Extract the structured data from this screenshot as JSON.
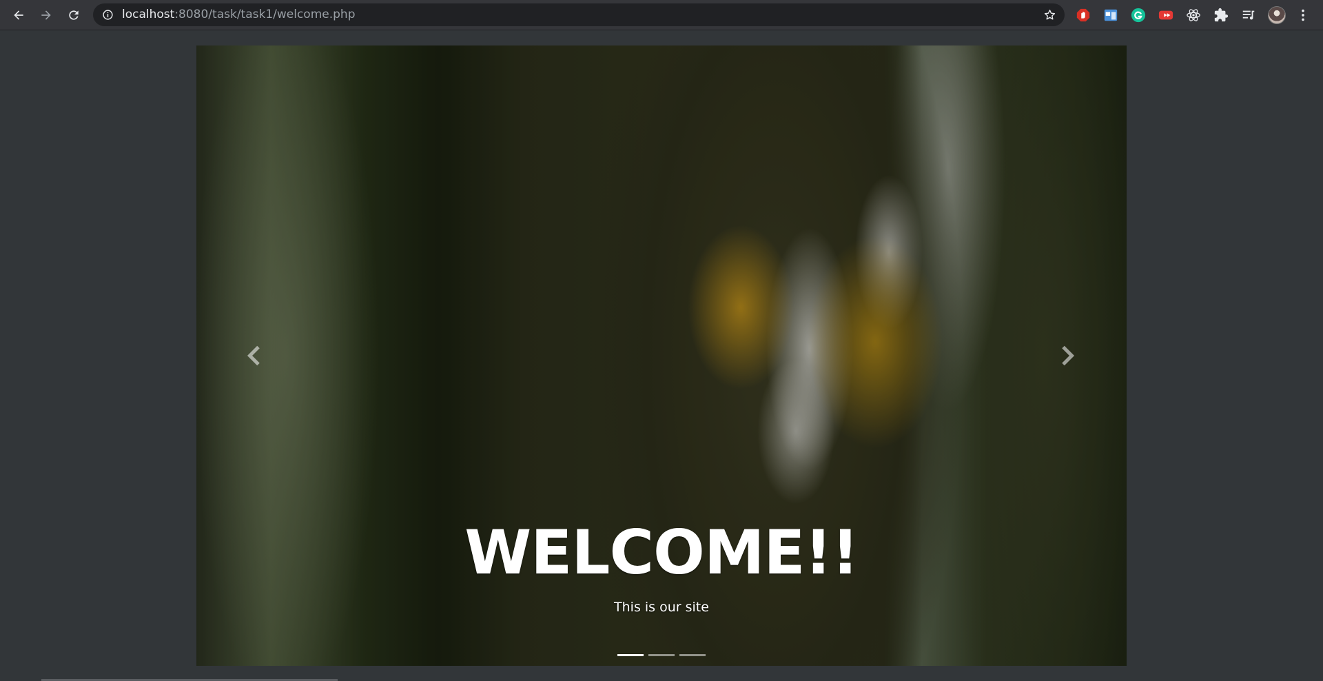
{
  "browser": {
    "back_icon": "arrow-left-icon",
    "forward_icon": "arrow-right-icon",
    "reload_icon": "reload-icon",
    "url_host": "localhost",
    "url_rest": ":8080/task/task1/welcome.php",
    "bookmark_icon": "star-icon",
    "extensions": [
      {
        "name": "adblock-icon",
        "color": "#d93025"
      },
      {
        "name": "window-icon",
        "color": "#4a90d9"
      },
      {
        "name": "grammarly-icon",
        "color": "#15c39a"
      },
      {
        "name": "youtube-icon",
        "color": "#e53935"
      },
      {
        "name": "react-icon",
        "color": "#e8eaed"
      },
      {
        "name": "puzzle-icon",
        "color": "#e8eaed"
      },
      {
        "name": "reading-list-icon",
        "color": "#e8eaed"
      }
    ],
    "menu_icon": "kebab-menu-icon"
  },
  "carousel": {
    "heading": "WELCOME!!",
    "subtitle": "This is our site",
    "active_slide": 1,
    "slide_count": 3
  }
}
